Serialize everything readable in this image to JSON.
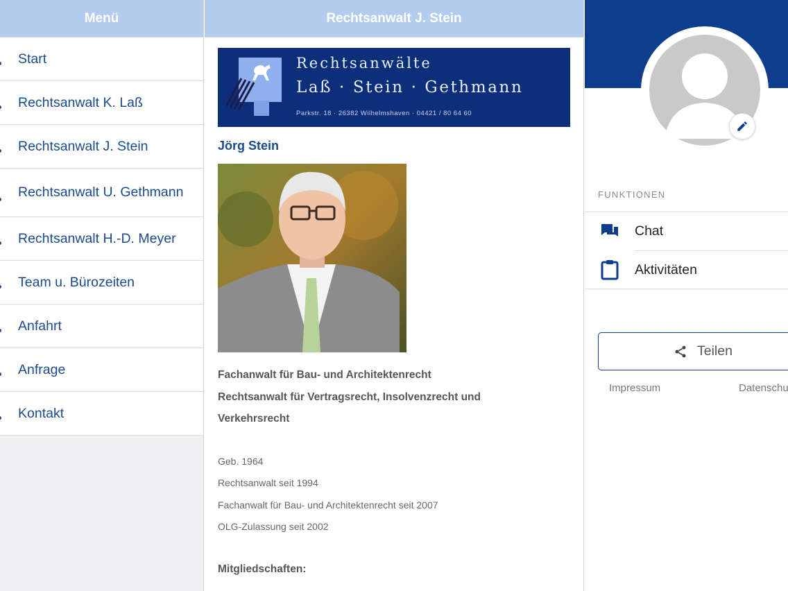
{
  "menu": {
    "title": "Menü",
    "items": [
      {
        "label": "Start"
      },
      {
        "label": "Rechtsanwalt K. Laß"
      },
      {
        "label": "Rechtsanwalt J. Stein"
      },
      {
        "label": "Rechtsanwalt U. Gethmann"
      },
      {
        "label": "Rechtsanwalt H.-D. Meyer"
      },
      {
        "label": "Team u. Bürozeiten"
      },
      {
        "label": "Anfahrt"
      },
      {
        "label": "Anfrage"
      },
      {
        "label": "Kontakt"
      }
    ]
  },
  "content": {
    "title": "Rechtsanwalt J. Stein",
    "banner": {
      "line1": "Rechtsanwälte",
      "line2": "Laß · Stein · Gethmann",
      "line3": "Parkstr. 18 · 26382 Wilhelmshaven · 04421 / 80 64 60"
    },
    "person_name": "Jörg Stein",
    "specialty": [
      "Fachanwalt für Bau- und Architektenrecht",
      "Rechtsanwalt für Vertragsrecht, Insolvenzrecht und",
      "Verkehrsrecht"
    ],
    "facts": [
      "Geb. 1964",
      "Rechtsanwalt seit 1994",
      "Fachanwalt für Bau- und Architektenrecht seit 2007",
      "OLG-Zulassung seit 2002"
    ],
    "memberships_title": "Mitgliedschaften:"
  },
  "profile": {
    "section_label": "FUNKTIONEN",
    "functions": [
      {
        "label": "Chat",
        "icon": "chat-icon"
      },
      {
        "label": "Aktivitäten",
        "icon": "clipboard-icon"
      }
    ],
    "share_label": "Teilen",
    "footer": {
      "impressum": "Impressum",
      "datenschutz": "Datenschu"
    }
  },
  "colors": {
    "header": "#b3ccee",
    "menu_text": "#1a4a8c",
    "banner": "#0d2f7a",
    "profile_band": "#0d3d8c"
  }
}
